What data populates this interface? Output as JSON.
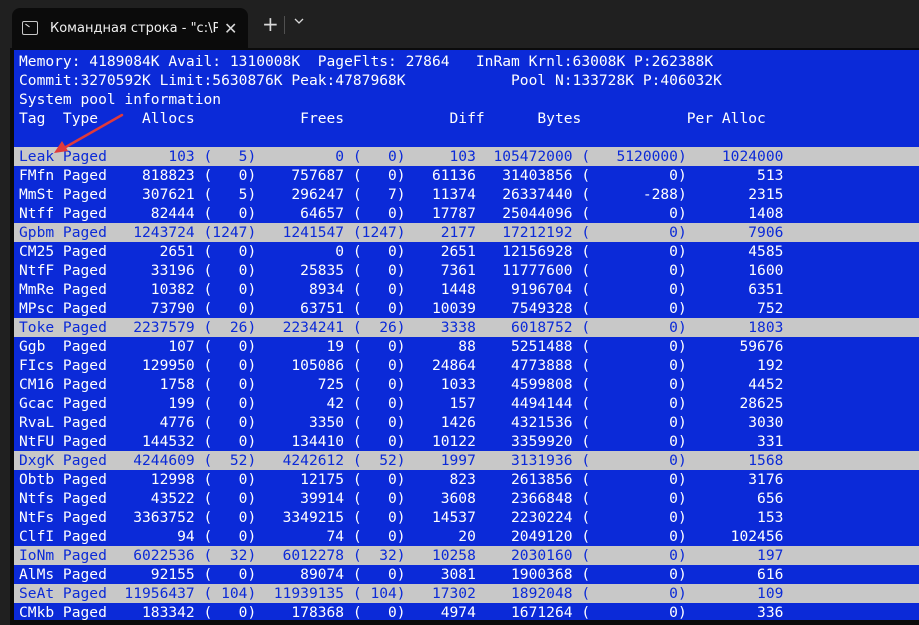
{
  "window": {
    "tab_title": "Командная строка - \"c:\\Progr",
    "close_glyph": "✕",
    "newtab_glyph": "+"
  },
  "header": {
    "line1": "Memory: 4189084K Avail: 1310008K  PageFlts: 27864   InRam Krnl:63008K P:262388K",
    "line2": "Commit:3270592K Limit:5630876K Peak:4787968K            Pool N:133728K P:406032K",
    "line3": "System pool information",
    "line4": "Tag  Type     Allocs            Frees            Diff      Bytes            Per Alloc"
  },
  "rows": [
    {
      "text": "Leak Paged       103 (   5)         0 (   0)     103  105472000 (   5120000)    1024000",
      "highlight": true
    },
    {
      "text": "FMfn Paged    818823 (   0)    757687 (   0)   61136   31403856 (         0)        513",
      "highlight": false
    },
    {
      "text": "MmSt Paged    307621 (   5)    296247 (   7)   11374   26337440 (      -288)       2315",
      "highlight": false
    },
    {
      "text": "Ntff Paged     82444 (   0)     64657 (   0)   17787   25044096 (         0)       1408",
      "highlight": false
    },
    {
      "text": "Gpbm Paged   1243724 (1247)   1241547 (1247)    2177   17212192 (         0)       7906",
      "highlight": true
    },
    {
      "text": "CM25 Paged      2651 (   0)         0 (   0)    2651   12156928 (         0)       4585",
      "highlight": false
    },
    {
      "text": "NtfF Paged     33196 (   0)     25835 (   0)    7361   11777600 (         0)       1600",
      "highlight": false
    },
    {
      "text": "MmRe Paged     10382 (   0)      8934 (   0)    1448    9196704 (         0)       6351",
      "highlight": false
    },
    {
      "text": "MPsc Paged     73790 (   0)     63751 (   0)   10039    7549328 (         0)        752",
      "highlight": false
    },
    {
      "text": "Toke Paged   2237579 (  26)   2234241 (  26)    3338    6018752 (         0)       1803",
      "highlight": true
    },
    {
      "text": "Ggb  Paged       107 (   0)        19 (   0)      88    5251488 (         0)      59676",
      "highlight": false
    },
    {
      "text": "FIcs Paged    129950 (   0)    105086 (   0)   24864    4773888 (         0)        192",
      "highlight": false
    },
    {
      "text": "CM16 Paged      1758 (   0)       725 (   0)    1033    4599808 (         0)       4452",
      "highlight": false
    },
    {
      "text": "Gcac Paged       199 (   0)        42 (   0)     157    4494144 (         0)      28625",
      "highlight": false
    },
    {
      "text": "RvaL Paged      4776 (   0)      3350 (   0)    1426    4321536 (         0)       3030",
      "highlight": false
    },
    {
      "text": "NtFU Paged    144532 (   0)    134410 (   0)   10122    3359920 (         0)        331",
      "highlight": false
    },
    {
      "text": "DxgK Paged   4244609 (  52)   4242612 (  52)    1997    3131936 (         0)       1568",
      "highlight": true
    },
    {
      "text": "Obtb Paged     12998 (   0)     12175 (   0)     823    2613856 (         0)       3176",
      "highlight": false
    },
    {
      "text": "Ntfs Paged     43522 (   0)     39914 (   0)    3608    2366848 (         0)        656",
      "highlight": false
    },
    {
      "text": "NtFs Paged   3363752 (   0)   3349215 (   0)   14537    2230224 (         0)        153",
      "highlight": false
    },
    {
      "text": "ClfI Paged        94 (   0)        74 (   0)      20    2049120 (         0)     102456",
      "highlight": false
    },
    {
      "text": "IoNm Paged   6022536 (  32)   6012278 (  32)   10258    2030160 (         0)        197",
      "highlight": true
    },
    {
      "text": "AlMs Paged     92155 (   0)     89074 (   0)    3081    1900368 (         0)        616",
      "highlight": false
    },
    {
      "text": "SeAt Paged  11956437 ( 104)  11939135 ( 104)   17302    1892048 (         0)        109",
      "highlight": true
    },
    {
      "text": "CMkb Paged    183342 (   0)    178368 (   0)    4974    1671264 (         0)        336",
      "highlight": false
    }
  ],
  "colors": {
    "screen_bg": "#0b2ad8",
    "highlight_bg": "#c8c8c8",
    "arrow": "#e03a3a"
  }
}
